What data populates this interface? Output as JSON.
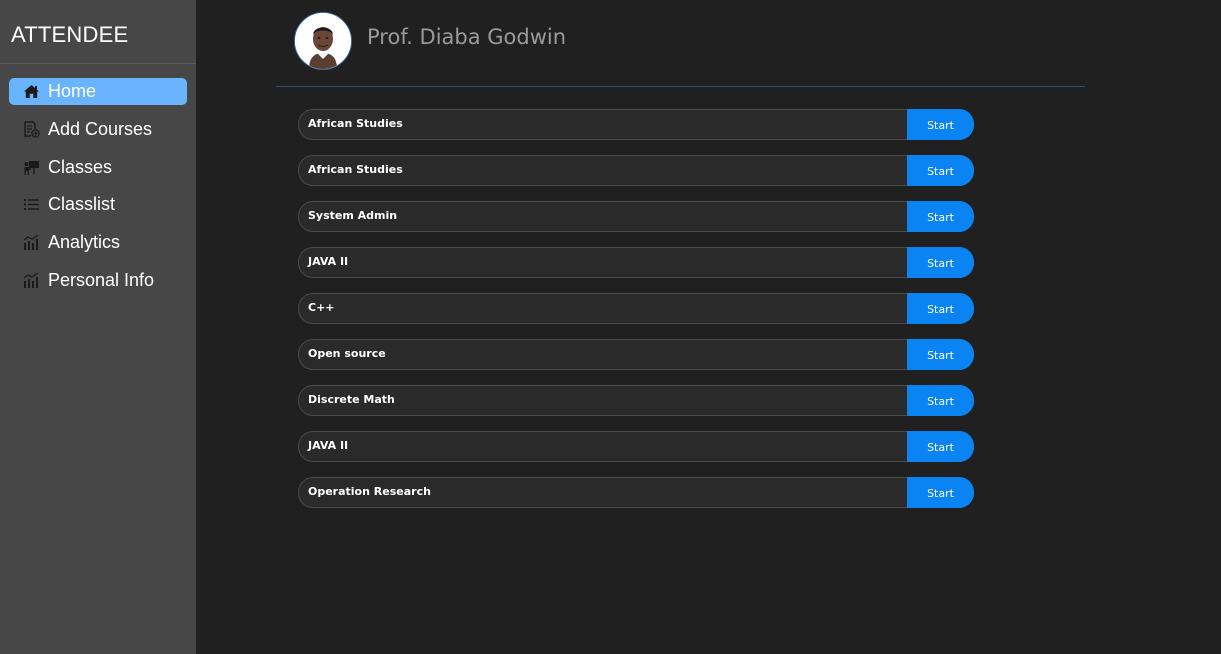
{
  "app": {
    "brand": "ATTENDEE"
  },
  "sidebar": {
    "items": [
      {
        "label": "Home",
        "icon": "home-icon",
        "active": true
      },
      {
        "label": "Add Courses",
        "icon": "add-document-icon",
        "active": false
      },
      {
        "label": "Classes",
        "icon": "presentation-icon",
        "active": false
      },
      {
        "label": "Classlist",
        "icon": "list-icon",
        "active": false
      },
      {
        "label": "Analytics",
        "icon": "bar-chart-icon",
        "active": false
      },
      {
        "label": "Personal Info",
        "icon": "bar-chart-icon",
        "active": false
      }
    ]
  },
  "header": {
    "name": "Prof. Diaba Godwin",
    "avatar_icon": "user-avatar"
  },
  "courses": {
    "button_label": "Start",
    "items": [
      {
        "name": "African Studies"
      },
      {
        "name": "African Studies"
      },
      {
        "name": "System Admin"
      },
      {
        "name": "JAVA II"
      },
      {
        "name": "C++"
      },
      {
        "name": "Open source"
      },
      {
        "name": "Discrete Math"
      },
      {
        "name": "JAVA II"
      },
      {
        "name": "Operation Research"
      }
    ]
  },
  "colors": {
    "sidebar_bg": "#474747",
    "main_bg": "#202020",
    "active_nav": "#6ab4ff",
    "start_button": "#0a84f2"
  }
}
